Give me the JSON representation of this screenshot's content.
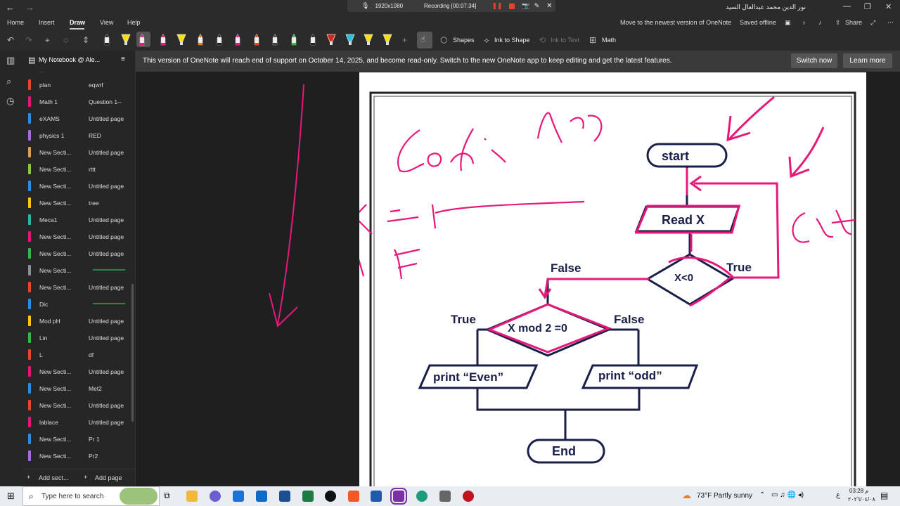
{
  "titlebar": {
    "recording": {
      "resolution": "1920x1080",
      "status": "Recording [00:07:34]"
    },
    "user_name": "نور الدين محمد عبدالعال السيد"
  },
  "menu": {
    "items": [
      "Home",
      "Insert",
      "Draw",
      "View",
      "Help"
    ],
    "active": "Draw",
    "move_newest": "Move to the newest version of OneNote",
    "saved": "Saved offline",
    "share": "Share"
  },
  "toolbar": {
    "shapes": "Shapes",
    "ink_to_shape": "Ink to Shape",
    "ink_to_text": "Ink to Text",
    "math": "Math",
    "pens": [
      {
        "color": "#222222",
        "type": "pen"
      },
      {
        "color": "#f5e10c",
        "type": "highlighter"
      },
      {
        "color": "#e8177a",
        "type": "pen"
      },
      {
        "color": "#e8177a",
        "type": "pen"
      },
      {
        "color": "#f5e10c",
        "type": "highlighter"
      },
      {
        "color": "#e07c1e",
        "type": "pen"
      },
      {
        "color": "#222222",
        "type": "pen"
      },
      {
        "color": "#e8177a",
        "type": "pen"
      },
      {
        "color": "#e04a1b",
        "type": "pen"
      },
      {
        "color": "#444444",
        "type": "pen"
      },
      {
        "color": "#39b54a",
        "type": "pen"
      },
      {
        "color": "#222222",
        "type": "pen"
      },
      {
        "color": "#e2231a",
        "type": "highlighter"
      },
      {
        "color": "#22c3e6",
        "type": "highlighter"
      },
      {
        "color": "#f5e10c",
        "type": "highlighter"
      },
      {
        "color": "#f5e10c",
        "type": "highlighter"
      }
    ]
  },
  "notebook": {
    "name": "My Notebook @ Ale...",
    "sections": [
      {
        "name": "plan",
        "color": "#e8432d",
        "page": "eqwrf"
      },
      {
        "name": "Math 1",
        "color": "#e2177a",
        "page": "Question 1--"
      },
      {
        "name": "eXAMS",
        "color": "#2a8ce0",
        "page": "Untitled page"
      },
      {
        "name": "physics 1",
        "color": "#a66bd6",
        "page": "RED"
      },
      {
        "name": "New Secti...",
        "color": "#d9a05b",
        "page": "Untitled page"
      },
      {
        "name": "New Secti...",
        "color": "#8cc63f",
        "page": "rttt"
      },
      {
        "name": "New Secti...",
        "color": "#2a8ce0",
        "page": "Untitled page"
      },
      {
        "name": "New Secti...",
        "color": "#f5c518",
        "page": "tree"
      },
      {
        "name": "Meca1",
        "color": "#2bb5a5",
        "page": "Untitled page"
      },
      {
        "name": "New Secti...",
        "color": "#e2177a",
        "page": "Untitled page"
      },
      {
        "name": "New Secti...",
        "color": "#39b54a",
        "page": "Untitled page"
      },
      {
        "name": "New Secti...",
        "color": "#8a8f98",
        "page": ""
      },
      {
        "name": "New Secti...",
        "color": "#e8432d",
        "page": "Untitled page"
      },
      {
        "name": "Dic",
        "color": "#2a8ce0",
        "page": ""
      },
      {
        "name": "Mod pH",
        "color": "#f5c518",
        "page": "Untitled page"
      },
      {
        "name": "Lin",
        "color": "#39b54a",
        "page": "Untitled page"
      },
      {
        "name": "L",
        "color": "#e8432d",
        "page": "df"
      },
      {
        "name": "New Secti...",
        "color": "#e2177a",
        "page": "Untitled page"
      },
      {
        "name": "New Secti...",
        "color": "#2a8ce0",
        "page": "Met2"
      },
      {
        "name": "New Secti...",
        "color": "#e8432d",
        "page": "Untitled page"
      },
      {
        "name": "lablace",
        "color": "#e2177a",
        "page": "Untitled page"
      },
      {
        "name": "New Secti...",
        "color": "#2a8ce0",
        "page": "Pr 1"
      },
      {
        "name": "New Secti...",
        "color": "#a66bd6",
        "page": "Pr2"
      }
    ],
    "add_section": "Add sect...",
    "add_page": "Add page"
  },
  "banner": {
    "message": "This version of OneNote will reach end of support on October 14, 2025, and become read-only. Switch to the new OneNote app to keep editing and get the latest features.",
    "switch_now": "Switch now",
    "learn_more": "Learn more"
  },
  "flowchart": {
    "start": "start",
    "read": "Read X",
    "decision1": "X<0",
    "true1": "True",
    "false1": "False",
    "decision2": "X mod 2 =0",
    "true2": "True",
    "false2": "False",
    "print_even": "print “Even”",
    "print_odd": "print “odd”",
    "end": "End"
  },
  "taskbar": {
    "search": "Type here to search",
    "weather": "73°F  Partly sunny",
    "time": "03:28 م",
    "date": "٢٠٢٦/٠٤/٠٨",
    "lang": "ع"
  }
}
